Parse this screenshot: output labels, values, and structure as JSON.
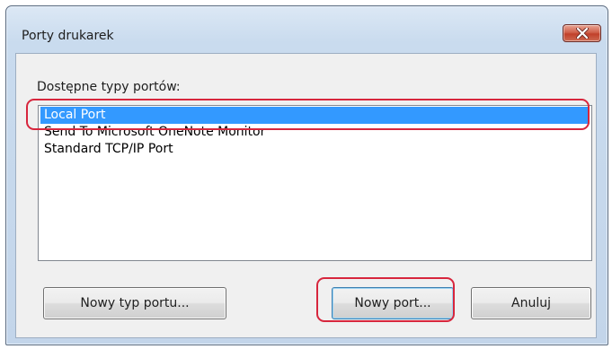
{
  "window": {
    "title": "Porty drukarek",
    "close_icon": "close-x-icon"
  },
  "ports_label": "Dostępne typy portów:",
  "port_types": [
    {
      "label": "Local Port",
      "selected": true
    },
    {
      "label": "Send To Microsoft OneNote Monitor",
      "selected": false
    },
    {
      "label": "Standard TCP/IP Port",
      "selected": false
    }
  ],
  "buttons": {
    "new_port_type": "Nowy typ portu...",
    "new_port": "Nowy port...",
    "cancel": "Anuluj"
  },
  "colors": {
    "selection": "#3399ff",
    "highlight_annotation": "#d7263d"
  }
}
